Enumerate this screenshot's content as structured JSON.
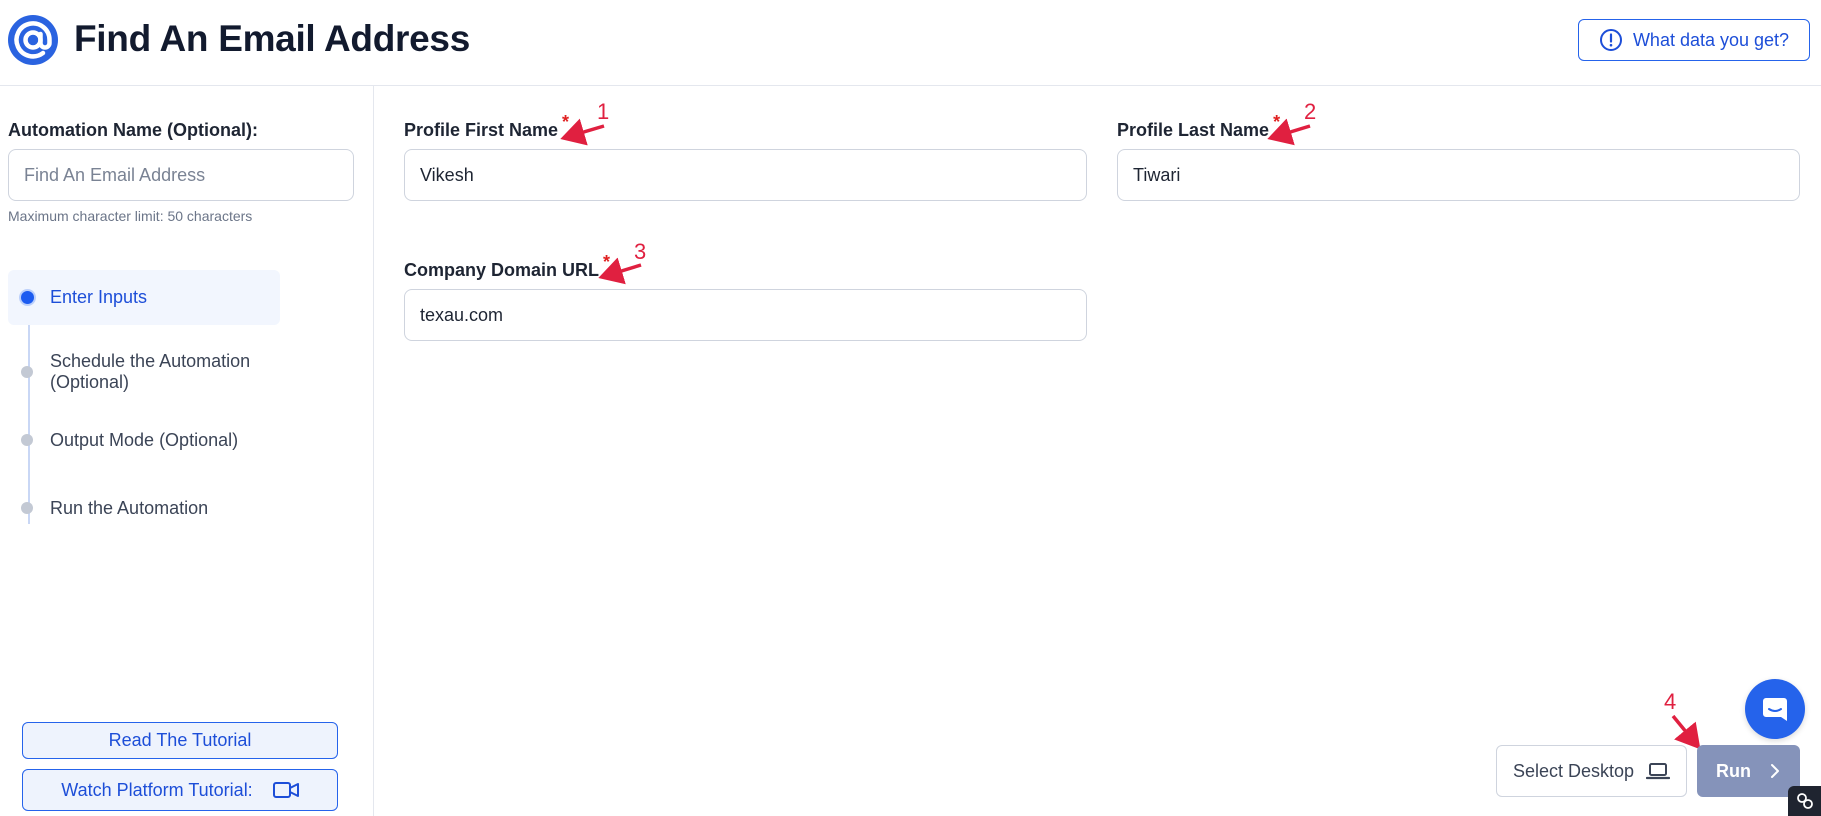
{
  "header": {
    "title": "Find An Email Address",
    "info_button_label": "What data you get?"
  },
  "sidebar": {
    "automation_name_label": "Automation Name (Optional):",
    "automation_name_placeholder": "Find An Email Address",
    "char_limit_hint": "Maximum character limit: 50 characters",
    "steps": [
      {
        "label": "Enter Inputs",
        "active": true
      },
      {
        "label": "Schedule the Automation (Optional)",
        "active": false
      },
      {
        "label": "Output Mode (Optional)",
        "active": false
      },
      {
        "label": "Run the Automation",
        "active": false
      }
    ],
    "read_tutorial_label": "Read The Tutorial",
    "watch_tutorial_label": "Watch Platform Tutorial:"
  },
  "form": {
    "first_name": {
      "label": "Profile First Name",
      "required_mark": "*",
      "value": "Vikesh"
    },
    "last_name": {
      "label": "Profile Last Name",
      "required_mark": "*",
      "value": "Tiwari"
    },
    "company_domain": {
      "label": "Company Domain URL",
      "required_mark": "*",
      "value": "texau.com"
    }
  },
  "annotations": [
    "1",
    "2",
    "3",
    "4"
  ],
  "actions": {
    "select_desktop_label": "Select Desktop",
    "run_label": "Run"
  },
  "colors": {
    "accent": "#2563eb",
    "annotation": "#e02040",
    "run_button": "#8593ba"
  }
}
